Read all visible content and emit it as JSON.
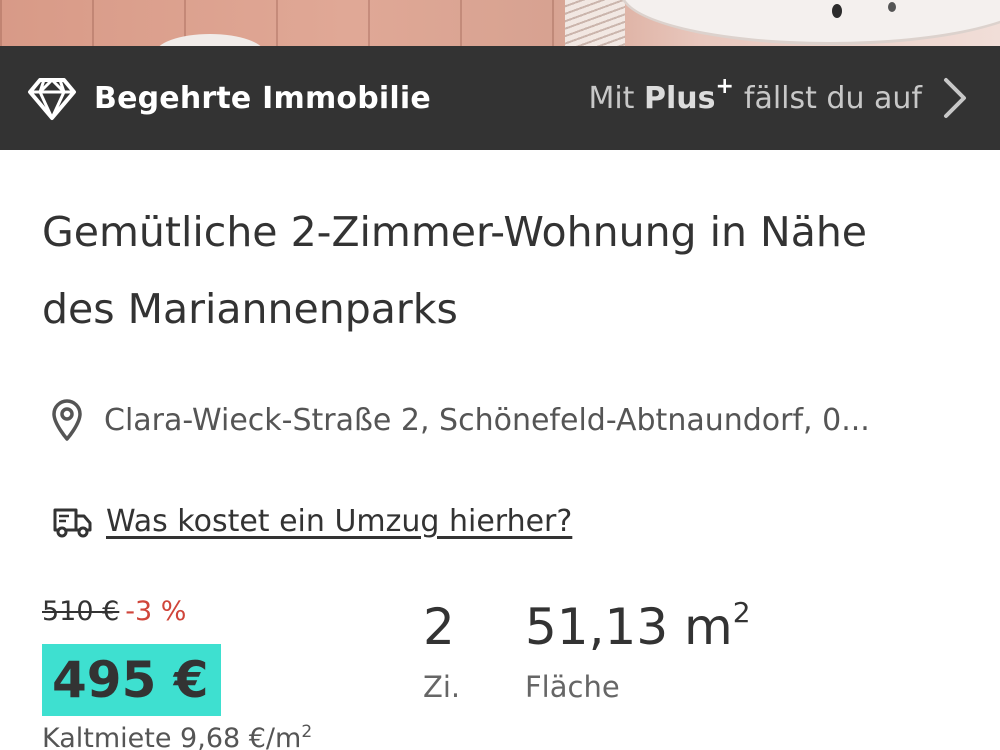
{
  "banner": {
    "title": "Begehrte Immobilie",
    "plus_prefix": "Mit",
    "plus_word": "Plus",
    "plus_sup": "+",
    "plus_suffix": "fällst du auf",
    "icons": {
      "badge": "diamond-icon",
      "arrow": "chevron-right-icon"
    },
    "colors": {
      "background": "#333333",
      "text": "#ffffff"
    }
  },
  "listing": {
    "title": "Gemütliche 2-Zimmer-Wohnung in Nähe des Mariannenparks",
    "address": "Clara-Wieck-Straße 2, Schönefeld-Abtnaundorf, 0...",
    "move_cost_link": "Was kostet ein Umzug hierher?",
    "icons": {
      "address": "location-pin-icon",
      "move": "moving-truck-icon"
    }
  },
  "price": {
    "old": "510 €",
    "discount": "-3 %",
    "current": "495 €",
    "per_sqm_label": "Kaltmiete 9,68 €/m",
    "per_sqm_sup": "2",
    "highlight_color": "#3ee0d0",
    "discount_color": "#d0453a"
  },
  "stats": {
    "rooms_value": "2",
    "rooms_label": "Zi.",
    "area_value": "51,13 m",
    "area_sup": "2",
    "area_label": "Fläche"
  }
}
